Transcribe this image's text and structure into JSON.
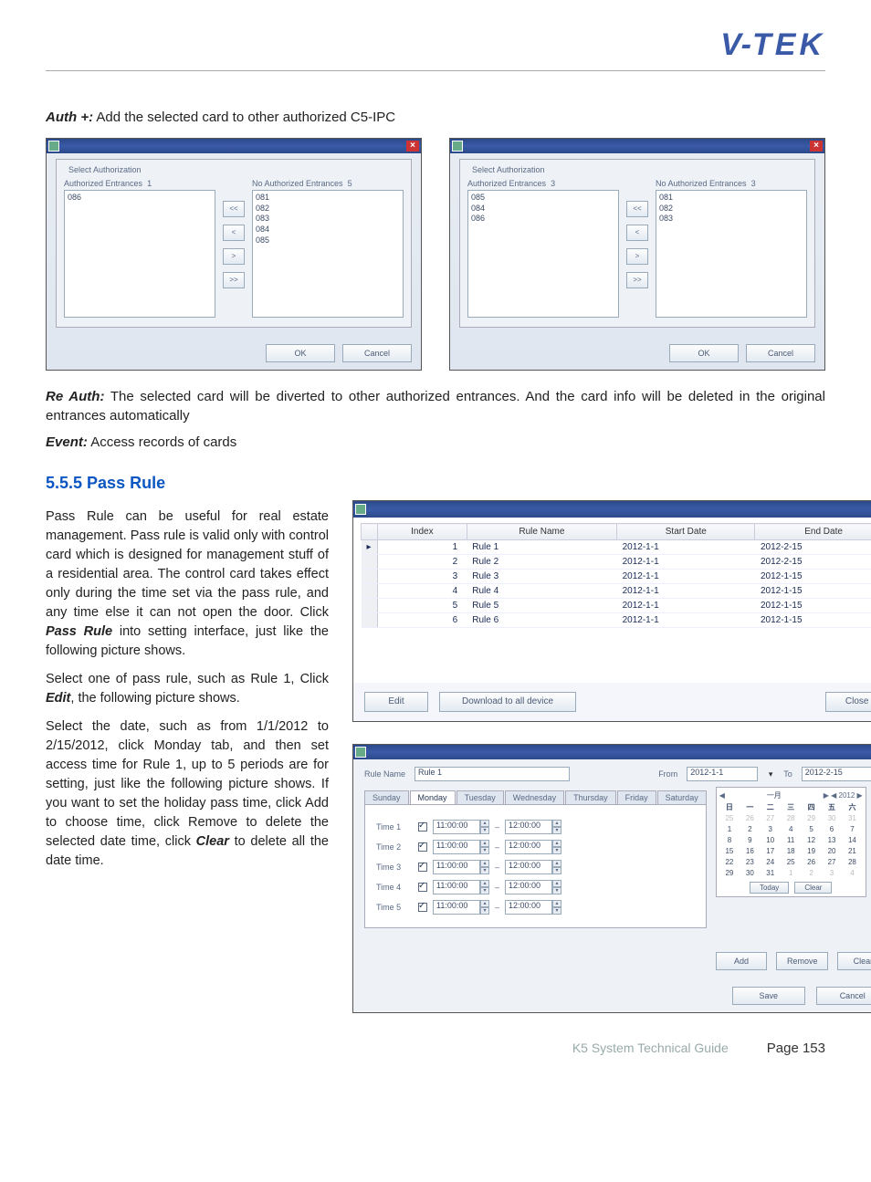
{
  "logo": {
    "v": "V",
    "dash": "-",
    "tek": "TEK"
  },
  "p_auth_plus": {
    "label": "Auth +:",
    "text": "Add the selected card to other authorized C5-IPC"
  },
  "auth_dlg": {
    "group": "Select Authorization",
    "left_label": "Authorized Entrances",
    "right_label": "No Authorized Entrances",
    "btn_ll": "<<",
    "btn_l": "<",
    "btn_r": ">",
    "btn_rr": ">>",
    "ok": "OK",
    "cancel": "Cancel",
    "left1_count": "1",
    "right1_count": "5",
    "left1": [
      "086"
    ],
    "right1": [
      "081",
      "082",
      "083",
      "084",
      "085"
    ],
    "left2_count": "3",
    "right2_count": "3",
    "left2": [
      "085",
      "084",
      "086"
    ],
    "right2": [
      "081",
      "082",
      "083"
    ]
  },
  "p_reauth": {
    "label": "Re Auth:",
    "text": "The selected card will be diverted to other authorized entrances. And the card info will be deleted in the original entrances automatically"
  },
  "p_event": {
    "label": "Event:",
    "text": "Access records of cards"
  },
  "section": "5.5.5 Pass Rule",
  "pass_p1_a": "Pass Rule can be useful for real estate management. Pass rule is valid only with control card which is designed for management stuff of a residential area. The control card takes effect only during the time set via the pass rule, and any time else it can not open the door. Click ",
  "pass_p1_b": "Pass Rule",
  "pass_p1_c": " into setting interface, just like the following picture shows.",
  "pass_p2_a": "Select one of pass rule, such as Rule 1, Click ",
  "pass_p2_b": "Edit",
  "pass_p2_c": ", the following picture shows.",
  "pass_p3_a": "Select the date, such as from 1/1/2012 to 2/15/2012, click Monday tab, and then set access time for Rule 1, up to 5 periods are for setting, just like the following picture shows. If you want to set the holiday pass time, click Add to choose time, click Remove to delete the selected date time, click ",
  "pass_p3_b": "Clear",
  "pass_p3_c": " to delete all the date time.",
  "rule_table": {
    "cols": [
      "Index",
      "Rule Name",
      "Start Date",
      "End Date"
    ],
    "rows": [
      [
        "1",
        "Rule 1",
        "2012-1-1",
        "2012-2-15"
      ],
      [
        "2",
        "Rule 2",
        "2012-1-1",
        "2012-2-15"
      ],
      [
        "3",
        "Rule 3",
        "2012-1-1",
        "2012-1-15"
      ],
      [
        "4",
        "Rule 4",
        "2012-1-1",
        "2012-1-15"
      ],
      [
        "5",
        "Rule 5",
        "2012-1-1",
        "2012-1-15"
      ],
      [
        "6",
        "Rule 6",
        "2012-1-1",
        "2012-1-15"
      ]
    ],
    "edit": "Edit",
    "download": "Download to all device",
    "close": "Close"
  },
  "edit_dlg": {
    "rule_name_lbl": "Rule Name",
    "rule_name": "Rule 1",
    "from_lbl": "From",
    "from": "2012-1-1",
    "to_lbl": "To",
    "to": "2012-2-15",
    "tabs": [
      "Sunday",
      "Monday",
      "Tuesday",
      "Wednesday",
      "Thursday",
      "Friday",
      "Saturday"
    ],
    "time_lbl": [
      "Time 1",
      "Time 2",
      "Time 3",
      "Time 4",
      "Time 5"
    ],
    "time_from": "11:00:00",
    "time_sep": "–",
    "time_to": "12:00:00",
    "cal_month": "一月",
    "cal_year": "2012",
    "cal_dow": [
      "日",
      "一",
      "二",
      "三",
      "四",
      "五",
      "六"
    ],
    "cal_rows": [
      [
        "25",
        "26",
        "27",
        "28",
        "29",
        "30",
        "31"
      ],
      [
        "1",
        "2",
        "3",
        "4",
        "5",
        "6",
        "7"
      ],
      [
        "8",
        "9",
        "10",
        "11",
        "12",
        "13",
        "14"
      ],
      [
        "15",
        "16",
        "17",
        "18",
        "19",
        "20",
        "21"
      ],
      [
        "22",
        "23",
        "24",
        "25",
        "26",
        "27",
        "28"
      ],
      [
        "29",
        "30",
        "31",
        "1",
        "2",
        "3",
        "4"
      ]
    ],
    "today": "Today",
    "clear_cal": "Clear",
    "add": "Add",
    "remove": "Remove",
    "clear": "Clear",
    "save": "Save",
    "cancel": "Cancel"
  },
  "footer": {
    "title": "K5 System Technical Guide",
    "page": "Page 153"
  }
}
